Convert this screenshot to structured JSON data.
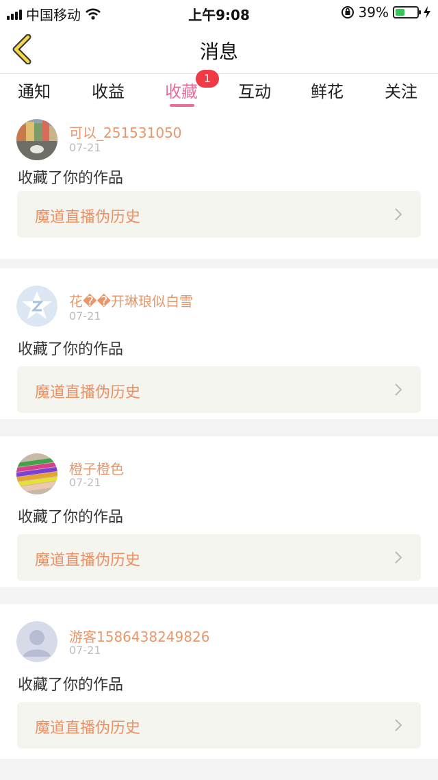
{
  "status_bar": {
    "carrier": "中国移动",
    "time": "上午9:08",
    "battery_percent": "39%",
    "battery_level": 0.39
  },
  "header": {
    "title": "消息"
  },
  "tabs": [
    {
      "label": "通知"
    },
    {
      "label": "收益"
    },
    {
      "label": "收藏",
      "active": true,
      "badge": "1"
    },
    {
      "label": "互动"
    },
    {
      "label": "鲜花"
    },
    {
      "label": "关注"
    }
  ],
  "messages": [
    {
      "user": "可以_251531050",
      "date": "07-21",
      "action": "收藏了你的作品",
      "work": "魔道直播伪历史",
      "avatar": "photo-avatar"
    },
    {
      "user": "花��开琳琅似白雪",
      "date": "07-21",
      "action": "收藏了你的作品",
      "work": "魔道直播伪历史",
      "avatar": "qq-default-avatar"
    },
    {
      "user": "橙子橙色",
      "date": "07-21",
      "action": "收藏了你的作品",
      "work": "魔道直播伪历史",
      "avatar": "colored-pencils-avatar"
    },
    {
      "user": "游客1586438249826",
      "date": "07-21",
      "action": "收藏了你的作品",
      "work": "魔道直播伪历史",
      "avatar": "default-person-avatar"
    }
  ],
  "colors": {
    "accent": "#ea6d9e",
    "username": "#e9976a",
    "work_title": "#ef8e60",
    "badge": "#f03a45"
  }
}
